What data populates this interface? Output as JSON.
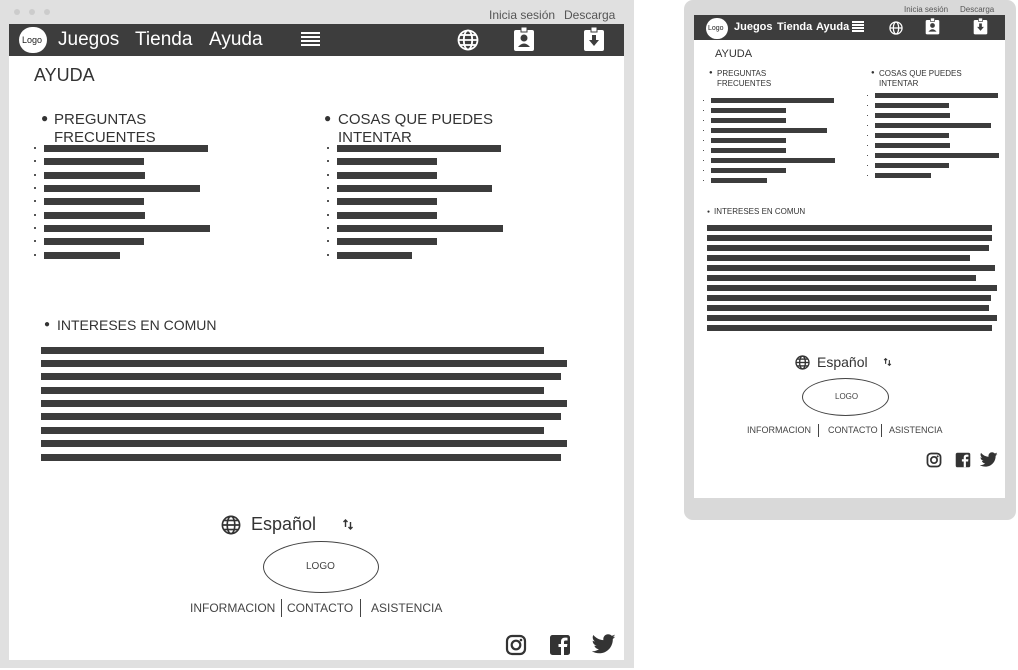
{
  "desktop": {
    "top_links": {
      "login": "Inicia sesión",
      "download": "Descarga"
    },
    "nav": {
      "logo": "Logo",
      "items": [
        "Juegos",
        "Tienda",
        "Ayuda"
      ]
    },
    "page_title": "AYUDA",
    "faq": {
      "title_line1": "PREGUNTAS",
      "title_line2": "FRECUENTES"
    },
    "try": {
      "title_line1": "COSAS QUE PUEDES",
      "title_line2": "INTENTAR"
    },
    "interests": {
      "title": "INTERESES EN COMUN"
    },
    "language": {
      "label": "Español"
    },
    "footer": {
      "logo": "LOGO",
      "links": [
        "INFORMACION",
        "CONTACTO",
        "ASISTENCIA"
      ]
    }
  },
  "mobile": {
    "top_links": {
      "login": "Inicia sesión",
      "download": "Descarga"
    },
    "nav": {
      "logo": "Logo",
      "items": [
        "Juegos",
        "Tienda",
        "Ayuda"
      ]
    },
    "page_title": "AYUDA",
    "faq": {
      "title_line1": "PREGUNTAS",
      "title_line2": "FRECUENTES"
    },
    "try": {
      "title_line1": "COSAS QUE PUEDES",
      "title_line2": "INTENTAR"
    },
    "interests": {
      "title": "INTERESES EN COMUN"
    },
    "language": {
      "label": "Español"
    },
    "footer": {
      "logo": "LOGO",
      "links": [
        "INFORMACION",
        "CONTACTO",
        "ASISTENCIA"
      ]
    }
  },
  "icons": [
    "globe-icon",
    "contact-card-icon",
    "download-icon",
    "menu-icon",
    "sort-icon",
    "instagram-icon",
    "facebook-icon",
    "twitter-icon"
  ],
  "colors": {
    "nav_bg": "#3d3d3d",
    "frame": "#dedede",
    "text_bar": "#3c3c3c"
  }
}
